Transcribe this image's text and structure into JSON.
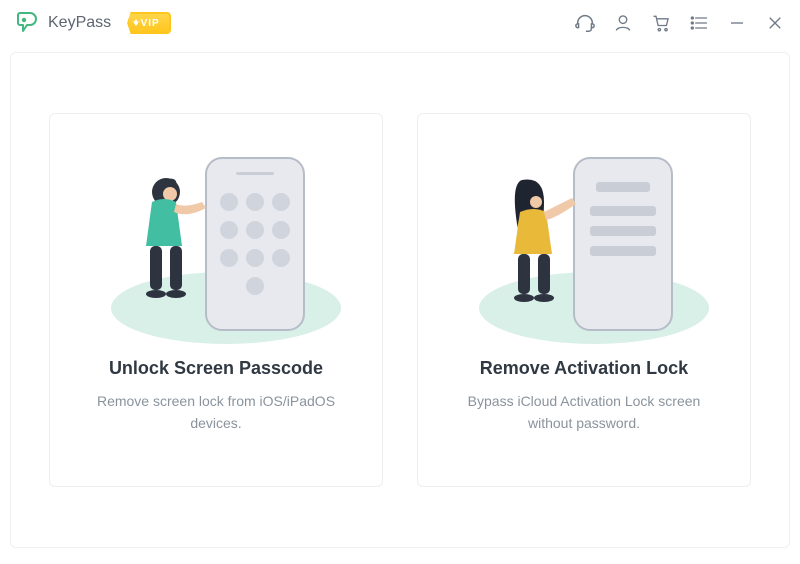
{
  "app": {
    "name": "KeyPass",
    "vip_label": "VIP"
  },
  "toolbar": {
    "icons": {
      "support": "headset-icon",
      "account": "user-icon",
      "cart": "cart-icon",
      "menu": "menu-icon",
      "minimize": "minimize-icon",
      "close": "close-icon"
    }
  },
  "cards": {
    "unlock": {
      "title": "Unlock Screen Passcode",
      "desc": "Remove screen lock from iOS/iPadOS devices."
    },
    "remove": {
      "title": "Remove Activation Lock",
      "desc": "Bypass iCloud Activation Lock screen without password."
    }
  },
  "colors": {
    "accent_green": "#43b77f",
    "accent_yellow": "#ffc61e",
    "illustration_teal": "#42bfa3",
    "illustration_yellow": "#e9b93a",
    "device_gray": "#c9ced6",
    "bg_oval": "#d9f0e8"
  }
}
